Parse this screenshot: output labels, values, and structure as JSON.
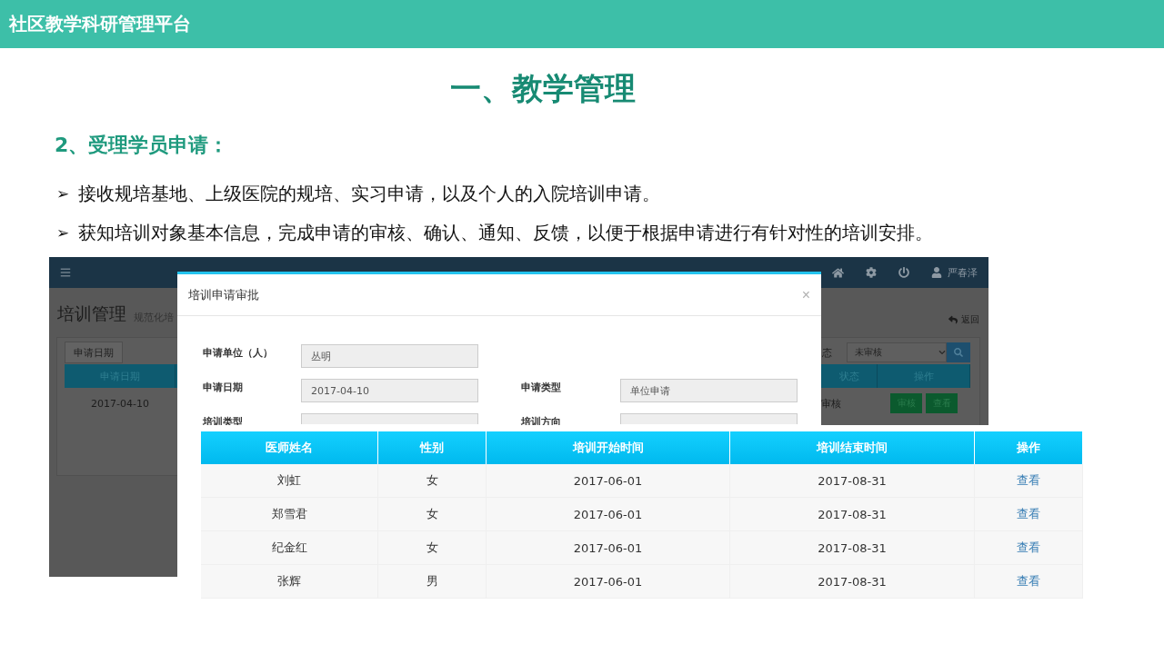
{
  "header": {
    "title": "社区教学科研管理平台"
  },
  "section_title": "一、教学管理",
  "subsection_title": "2、受理学员申请：",
  "bullets": [
    {
      "marker": "➢",
      "text": "接收规培基地、上级医院的规培、实习申请，以及个人的入院培训申请。"
    },
    {
      "marker": "➢",
      "text": "获知培训对象基本信息，完成申请的审核、确认、通知、反馈，以便于根据申请进行有针对性的培训安排。"
    }
  ],
  "app_screenshot": {
    "navbar": {
      "user": "严春泽"
    },
    "page_title": "培训管理",
    "page_subtitle": "规范化培",
    "back_link": "返回",
    "filter_tab": "申请日期",
    "search_label": "态",
    "status_select": "未审核",
    "table": {
      "columns": [
        "申请日期",
        "状态",
        "操作"
      ],
      "rows": [
        {
          "date": "2017-04-10",
          "status": "审核",
          "actions": [
            "审核",
            "查看"
          ]
        }
      ]
    },
    "modal": {
      "title": "培训申请审批",
      "close": "×",
      "rows": [
        [
          {
            "label": "申请单位（人）",
            "value": "丛明"
          }
        ],
        [
          {
            "label": "申请日期",
            "value": "2017-04-10"
          },
          {
            "label": "申请类型",
            "value": "单位申请"
          }
        ],
        [
          {
            "label": "培训类型"
          },
          {
            "label": "培训方向"
          }
        ]
      ]
    }
  },
  "trainee_table": {
    "columns": [
      "医师姓名",
      "性别",
      "培训开始时间",
      "培训结束时间",
      "操作"
    ],
    "rows": [
      {
        "name": "刘虹",
        "gender": "女",
        "start": "2017-06-01",
        "end": "2017-08-31",
        "action": "查看"
      },
      {
        "name": "郑雪君",
        "gender": "女",
        "start": "2017-06-01",
        "end": "2017-08-31",
        "action": "查看"
      },
      {
        "name": "纪金红",
        "gender": "女",
        "start": "2017-06-01",
        "end": "2017-08-31",
        "action": "查看"
      },
      {
        "name": "张辉",
        "gender": "男",
        "start": "2017-06-01",
        "end": "2017-08-31",
        "action": "查看"
      }
    ]
  }
}
